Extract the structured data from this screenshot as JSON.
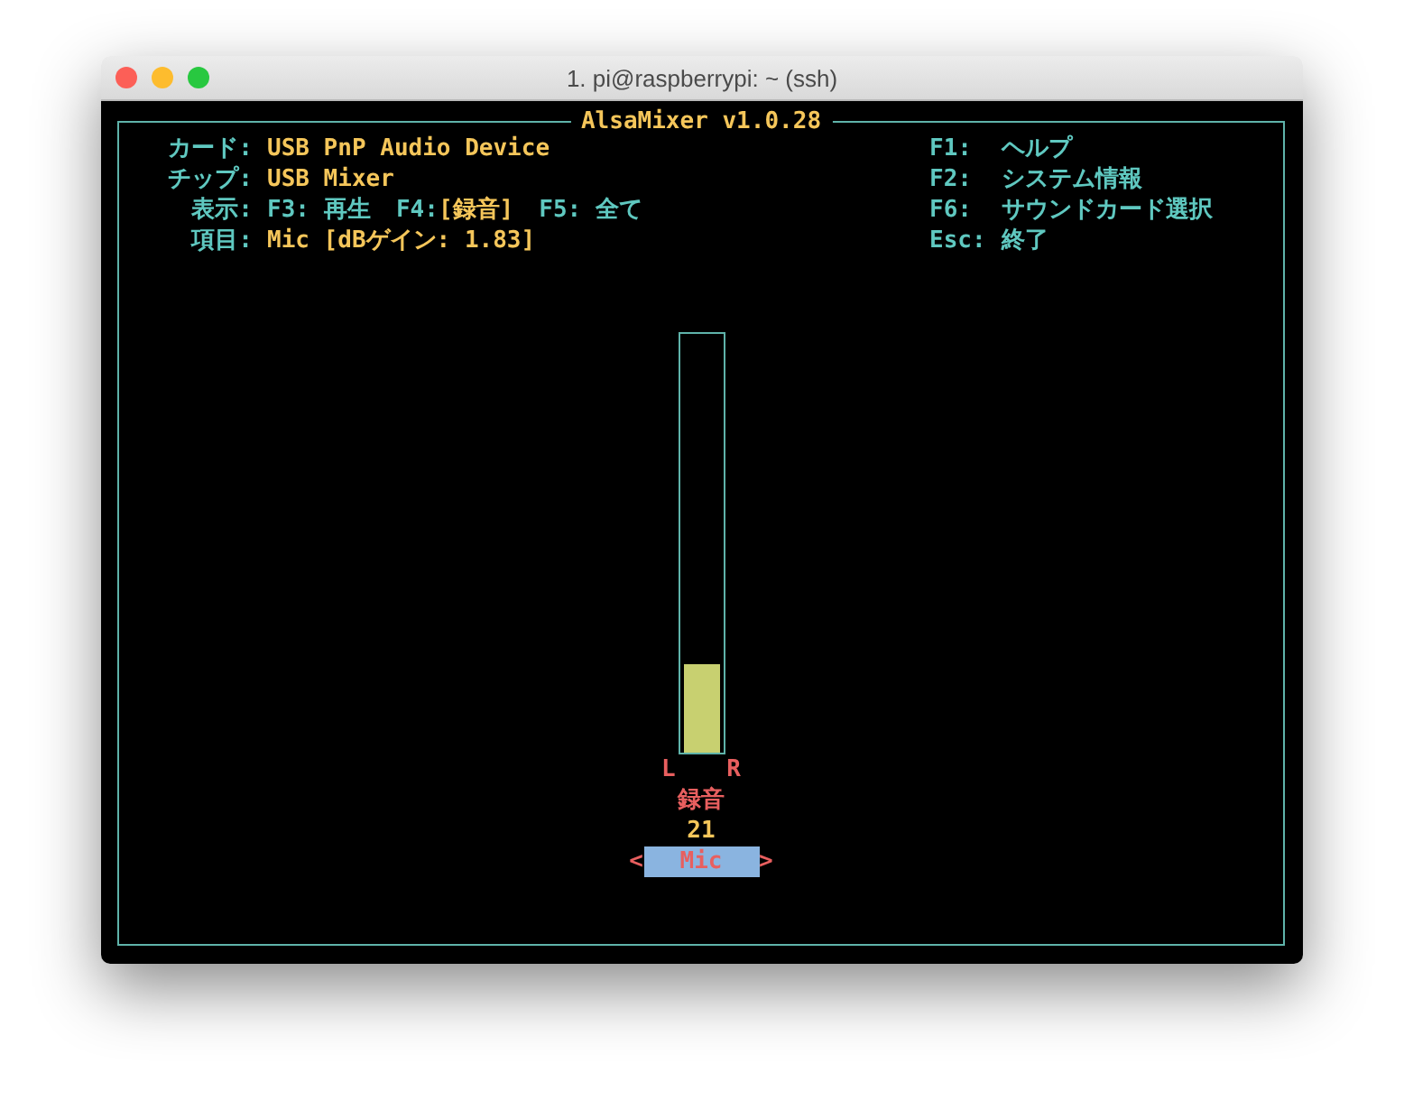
{
  "window": {
    "title": "1. pi@raspberrypi: ~ (ssh)"
  },
  "mixer": {
    "title": "AlsaMixer v1.0.28",
    "info": [
      {
        "label": "カード:",
        "value": "USB PnP Audio Device"
      },
      {
        "label": "チップ:",
        "value": "USB Mixer"
      }
    ],
    "view": {
      "label": "表示:",
      "modes": [
        {
          "key": "F3:",
          "name": "再生",
          "selected": false
        },
        {
          "key": "F4:",
          "name": "[録音]",
          "selected": true
        },
        {
          "key": "F5:",
          "name": "全て",
          "selected": false
        }
      ]
    },
    "item": {
      "label": "項目:",
      "value": "Mic [dBゲイン: 1.83]"
    },
    "keys": [
      {
        "key": "F1:",
        "action": "ヘルプ"
      },
      {
        "key": "F2:",
        "action": "システム情報"
      },
      {
        "key": "F6:",
        "action": "サウンドカード選択"
      },
      {
        "key": "Esc:",
        "action": "終了"
      }
    ],
    "control": {
      "level": 0.21,
      "left_label": "L",
      "right_label": "R",
      "mode": "録音",
      "value": "21",
      "prev": "<",
      "name": "Mic",
      "next": ">",
      "selected": true
    }
  }
}
